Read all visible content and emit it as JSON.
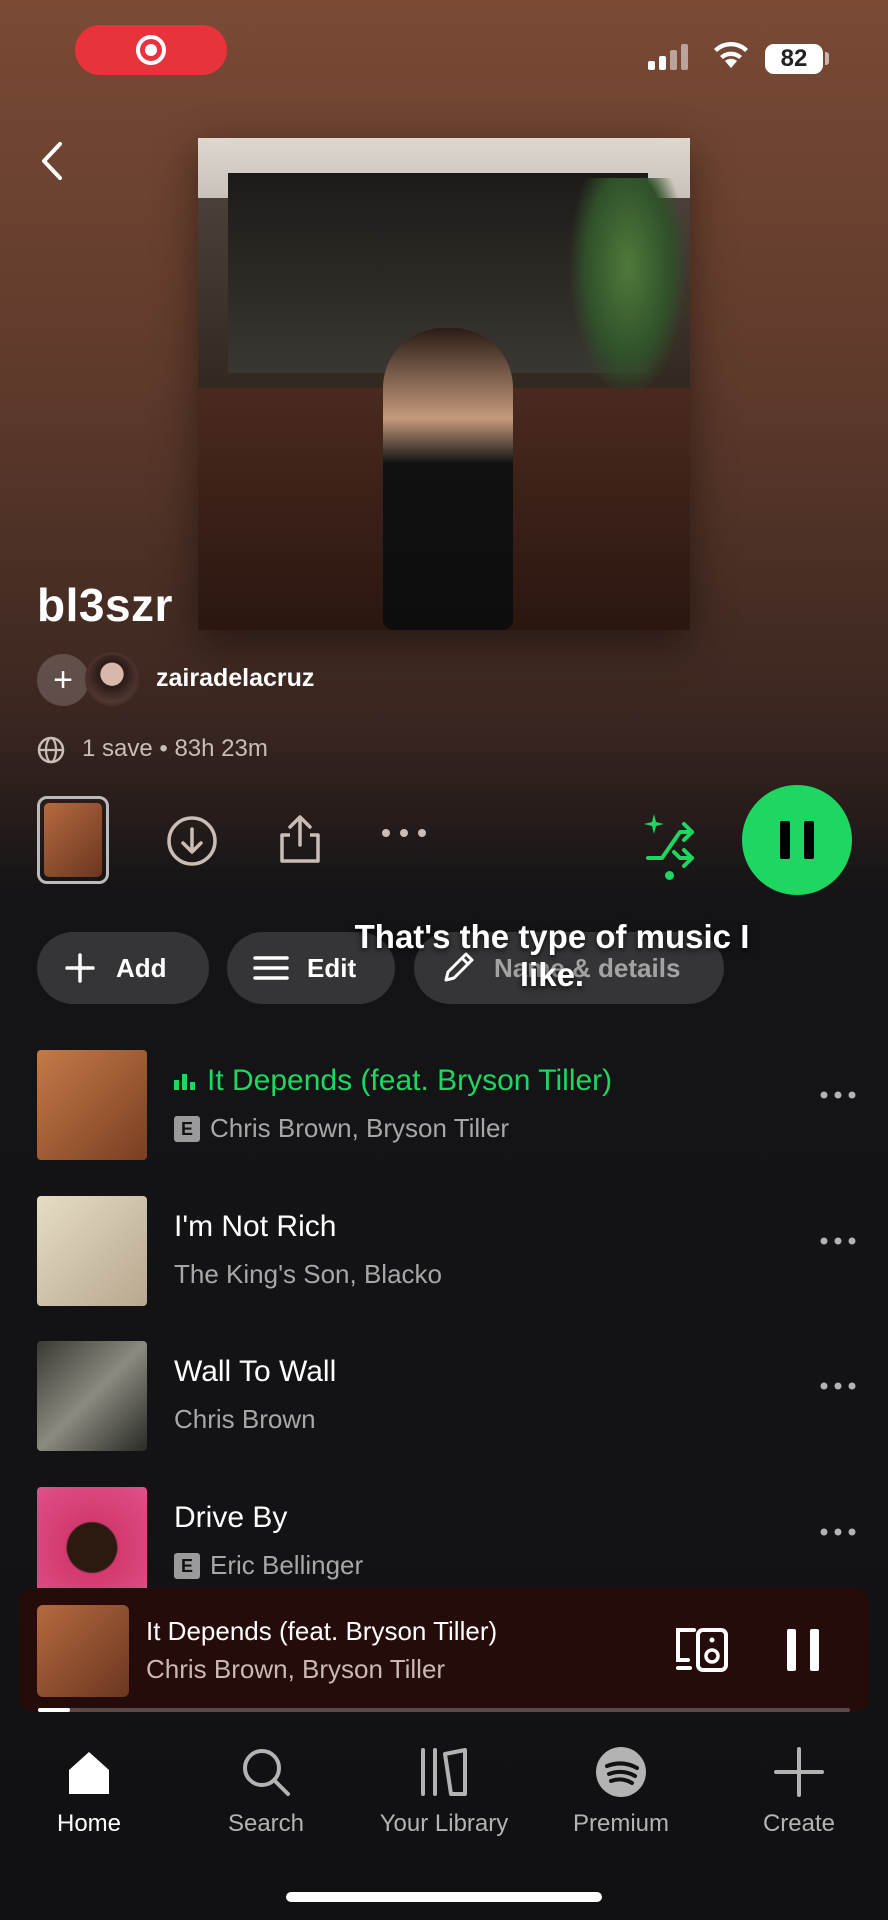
{
  "status": {
    "battery": "82"
  },
  "playlist": {
    "title": "bl3szr",
    "owner": "zairadelacruz",
    "meta": "1 save • 83h 23m"
  },
  "actions": {
    "add": "Add",
    "edit": "Edit",
    "name_details": "Name & details"
  },
  "caption": "That's the type of music I like.",
  "tracks": [
    {
      "title": "It Depends (feat. Bryson Tiller)",
      "artist": "Chris Brown, Bryson Tiller",
      "explicit": true,
      "playing": true
    },
    {
      "title": "I'm Not Rich",
      "artist": "The King's Son, Blacko",
      "explicit": false,
      "playing": false
    },
    {
      "title": "Wall To Wall",
      "artist": "Chris Brown",
      "explicit": false,
      "playing": false
    },
    {
      "title": "Drive By",
      "artist": "Eric Bellinger",
      "explicit": true,
      "playing": false
    }
  ],
  "now_playing": {
    "title": "It Depends (feat. Bryson Tiller)",
    "artist": "Chris Brown, Bryson Tiller",
    "progress": 0.04
  },
  "tabs": [
    {
      "label": "Home",
      "icon": "home-icon",
      "active": true
    },
    {
      "label": "Search",
      "icon": "search-icon",
      "active": false
    },
    {
      "label": "Your Library",
      "icon": "library-icon",
      "active": false
    },
    {
      "label": "Premium",
      "icon": "spotify-icon",
      "active": false
    },
    {
      "label": "Create",
      "icon": "plus-icon",
      "active": false
    }
  ],
  "colors": {
    "accent": "#1ed760",
    "recording": "#e8333d"
  }
}
